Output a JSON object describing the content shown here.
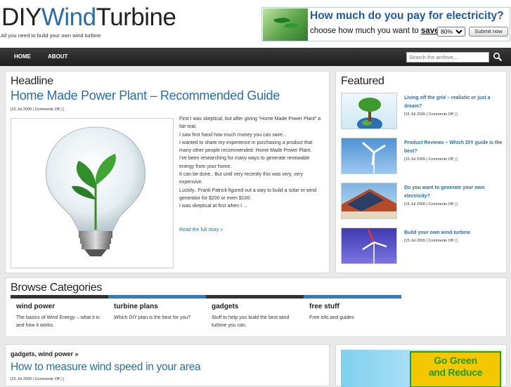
{
  "header": {
    "logo_part1": "DIY",
    "logo_part2": "Wind",
    "logo_part3": "Turbine",
    "tagline": "All you need to build your own wind turbine"
  },
  "ad": {
    "question": "How much do you pay for electricity?",
    "choose_prefix": "choose how much you want to ",
    "choose_word": "save",
    "choose_suffix": ":",
    "selected": "80%",
    "submit": "Submit now"
  },
  "nav": {
    "home": "HOME",
    "about": "ABOUT",
    "search_placeholder": "Search the archive..."
  },
  "headline": {
    "section": "Headline",
    "title": "Home Made Power Plant – Recommended Guide",
    "meta": "[15 Jul 2009 | Comments Off | ]",
    "paragraphs": [
      "First I was skeptical, but after giving “Home Made Power Plant” a fair trial.",
      "I saw first hand how much money you can save…",
      "I wanted to share my experience in purchasing a product that many other people recommended: Home Made Power Plant.",
      "I’ve been researching for many ways to generate renewable energy from your home.",
      "It can be done.. But until very recently this was very, very expensive.",
      "Luckily.. Frank Patrick figured out a way to build a solar or wind generator for $200 or even $100.",
      "I was skeptical at first when I …"
    ],
    "read_more": "Read the full story »"
  },
  "featured": {
    "section": "Featured",
    "items": [
      {
        "title": "Living off the grid – realistic or just a dream?",
        "meta": "[15 Jul 2009 | Comments Off | ]"
      },
      {
        "title": "Product Reviews – Which DIY guide is the best?",
        "meta": "[15 Jul 2009 | Comments Off | ]"
      },
      {
        "title": "Do you want to generate your own electricity?",
        "meta": "[15 Jul 2009 | Comments Off | ]"
      },
      {
        "title": "Build your own wind turbine",
        "meta": "[15 Jul 2009 | Comments Off | ]"
      }
    ]
  },
  "browse": {
    "section": "Browse Categories",
    "categories": [
      {
        "name": "wind power",
        "desc": "The basics of Wind Energy – what it is and how it works."
      },
      {
        "name": "turbine plans",
        "desc": "Which DIY plan is the best for you?"
      },
      {
        "name": "gadgets",
        "desc": "Stuff to help you build the best wind turbine you can."
      },
      {
        "name": "free stuff",
        "desc": "Free info and guides"
      }
    ]
  },
  "post2": {
    "category": "gadgets, wind power »",
    "title": "How to measure wind speed in your area",
    "meta": "[15 Jul 2009 | Comments Off | ]"
  },
  "ad2": {
    "line1": "Go Green",
    "line2": "and Reduce"
  },
  "colors": {
    "accent": "#2a6ea8",
    "nav_bg": "#1d1d1d",
    "category_bar_dark": "#333333",
    "category_bar_blue": "#3d78b4"
  }
}
